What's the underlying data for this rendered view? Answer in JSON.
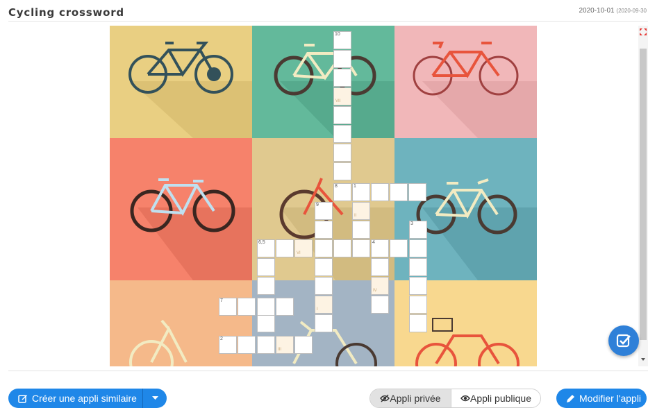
{
  "header": {
    "title": "Cycling crossword",
    "date": "2020-10-01",
    "date_created": "(2020-09-30"
  },
  "colors": {
    "accent": "#1f87e8",
    "highlight": "#fdf3e3"
  },
  "puzzle": {
    "numbers": [
      "10",
      "8",
      "1",
      "9",
      "3",
      "6,5",
      "4",
      "7",
      "2"
    ],
    "roman": [
      "VII",
      "II",
      "VI",
      "IV",
      "I",
      "III"
    ]
  },
  "icons": {
    "expand": "expand-icon",
    "check": "check-square-icon",
    "edit": "pencil-icon",
    "eye": "eye-icon",
    "eye_slash": "eye-slash-icon",
    "create": "edit-square-icon",
    "caret": "caret-down-icon"
  },
  "footer": {
    "create_label": "Créer une appli similaire",
    "private_label": "Appli privée",
    "public_label": "Appli publique",
    "edit_label": "Modifier l'appli"
  }
}
